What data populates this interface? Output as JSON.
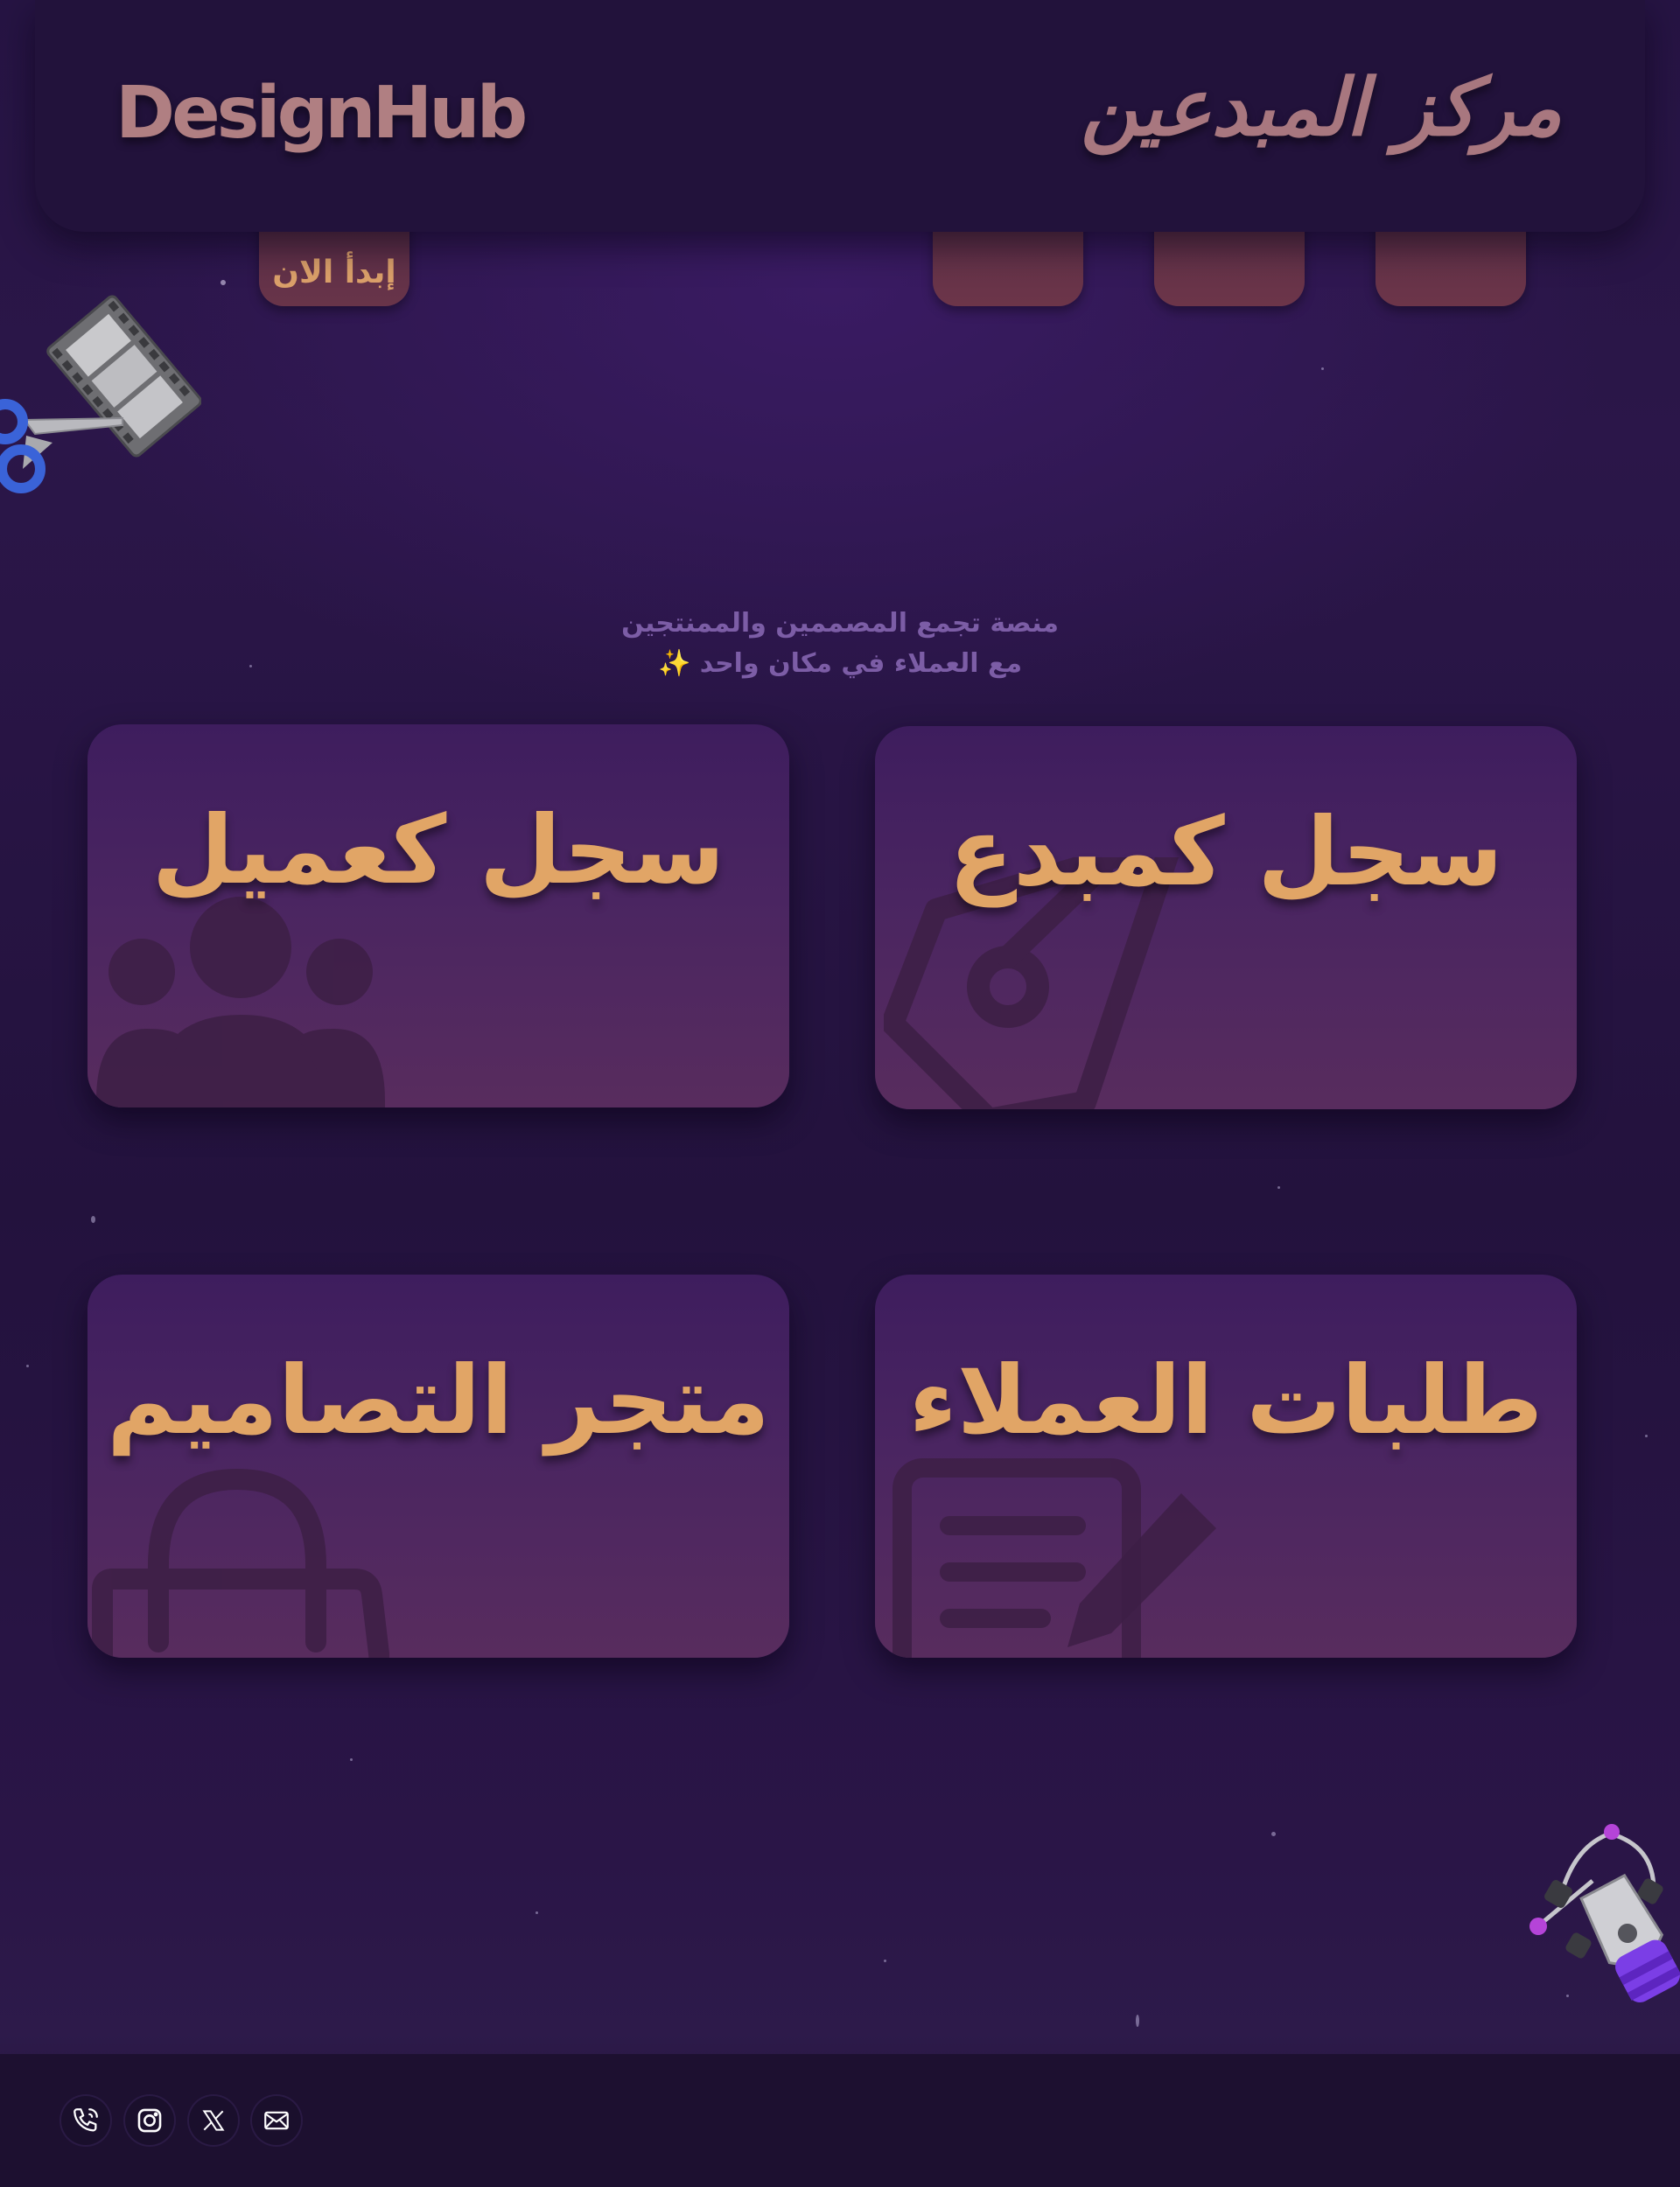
{
  "header": {
    "brand_en": "DesignHub",
    "brand_ar": "مركز المبدعين"
  },
  "nav": {
    "start_label": "إبدأ الان",
    "tabs": [
      "",
      "",
      ""
    ]
  },
  "hero": {
    "tagline_line1": "منصة تجمع المصممين والممنتجين",
    "tagline_line2": "مع العملاء في مكان واحد ✨"
  },
  "cards": [
    {
      "title": "سجل كمبدع",
      "icon": "pen-nib-icon"
    },
    {
      "title": "سجل كعميل",
      "icon": "users-icon"
    },
    {
      "title": "طلبات العملاء",
      "icon": "document-edit-icon"
    },
    {
      "title": "متجر التصاميم",
      "icon": "shopping-bag-icon"
    }
  ],
  "footer": {
    "social": [
      "phone-icon",
      "instagram-icon",
      "x-icon",
      "mail-icon"
    ]
  },
  "decorations": [
    "film-scissors-icon",
    "vector-pen-tool-icon"
  ],
  "colors": {
    "background": "#261443",
    "header": "#22123b",
    "card": "#4a2561",
    "accent_text": "#e1a566",
    "brand_text": "#b07f82",
    "tagline": "#7c5da6"
  }
}
